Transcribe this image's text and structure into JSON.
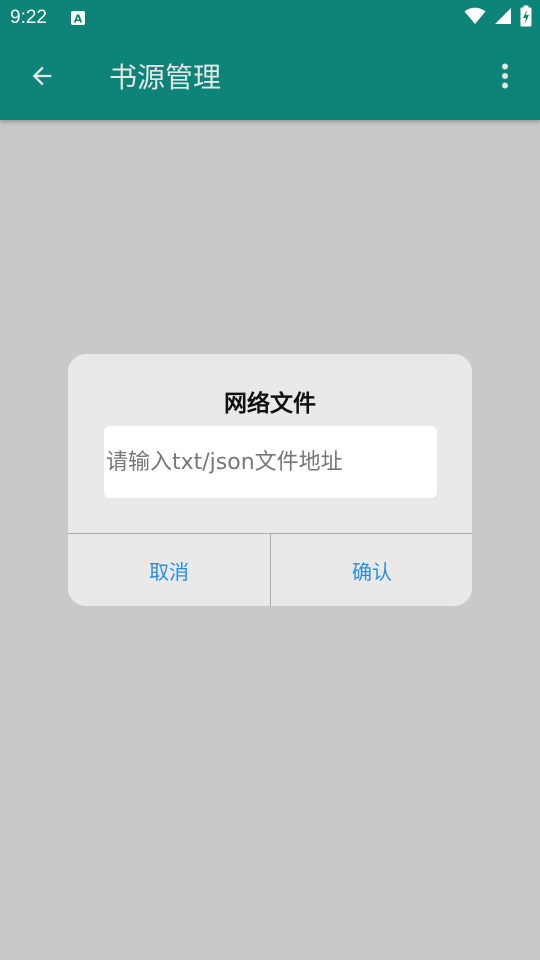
{
  "status_bar": {
    "time": "9:22",
    "icons": [
      "app-notification-icon",
      "wifi-icon",
      "signal-icon",
      "battery-charging-icon"
    ],
    "color": "#0e8478"
  },
  "app_bar": {
    "title": "书源管理",
    "back_icon": "arrow-back-icon",
    "menu_icon": "more-vert-icon",
    "color": "#0e8478"
  },
  "dialog": {
    "title": "网络文件",
    "input_placeholder": "请输入txt/json文件地址",
    "input_value": "",
    "cancel_label": "取消",
    "confirm_label": "确认",
    "button_color": "#2a8fd8"
  }
}
